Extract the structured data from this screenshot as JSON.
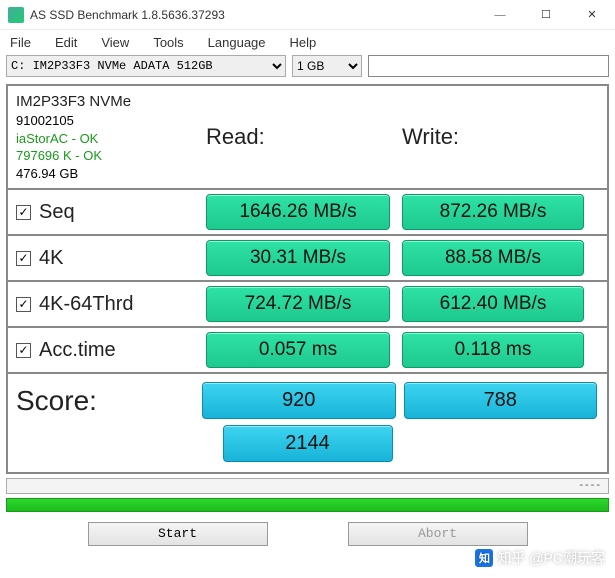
{
  "window": {
    "title": "AS SSD Benchmark 1.8.5636.37293"
  },
  "menu": {
    "file": "File",
    "edit": "Edit",
    "view": "View",
    "tools": "Tools",
    "language": "Language",
    "help": "Help"
  },
  "toolbar": {
    "drive": "C: IM2P33F3 NVMe ADATA 512GB",
    "size": "1 GB",
    "filter": ""
  },
  "device": {
    "name": "IM2P33F3 NVMe",
    "serial": "91002105",
    "driver": "iaStorAC - OK",
    "align": "797696 K - OK",
    "capacity": "476.94 GB"
  },
  "headers": {
    "read": "Read:",
    "write": "Write:"
  },
  "tests": {
    "seq": {
      "label": "Seq",
      "read": "1646.26 MB/s",
      "write": "872.26 MB/s"
    },
    "k4": {
      "label": "4K",
      "read": "30.31 MB/s",
      "write": "88.58 MB/s"
    },
    "k4t": {
      "label": "4K-64Thrd",
      "read": "724.72 MB/s",
      "write": "612.40 MB/s"
    },
    "acc": {
      "label": "Acc.time",
      "read": "0.057 ms",
      "write": "0.118 ms"
    }
  },
  "score": {
    "label": "Score:",
    "read": "920",
    "write": "788",
    "total": "2144"
  },
  "progress": {
    "text": "----"
  },
  "buttons": {
    "start": "Start",
    "abort": "Abort"
  },
  "watermark": {
    "logo": "知",
    "text": "知乎 @PC潮玩客"
  }
}
